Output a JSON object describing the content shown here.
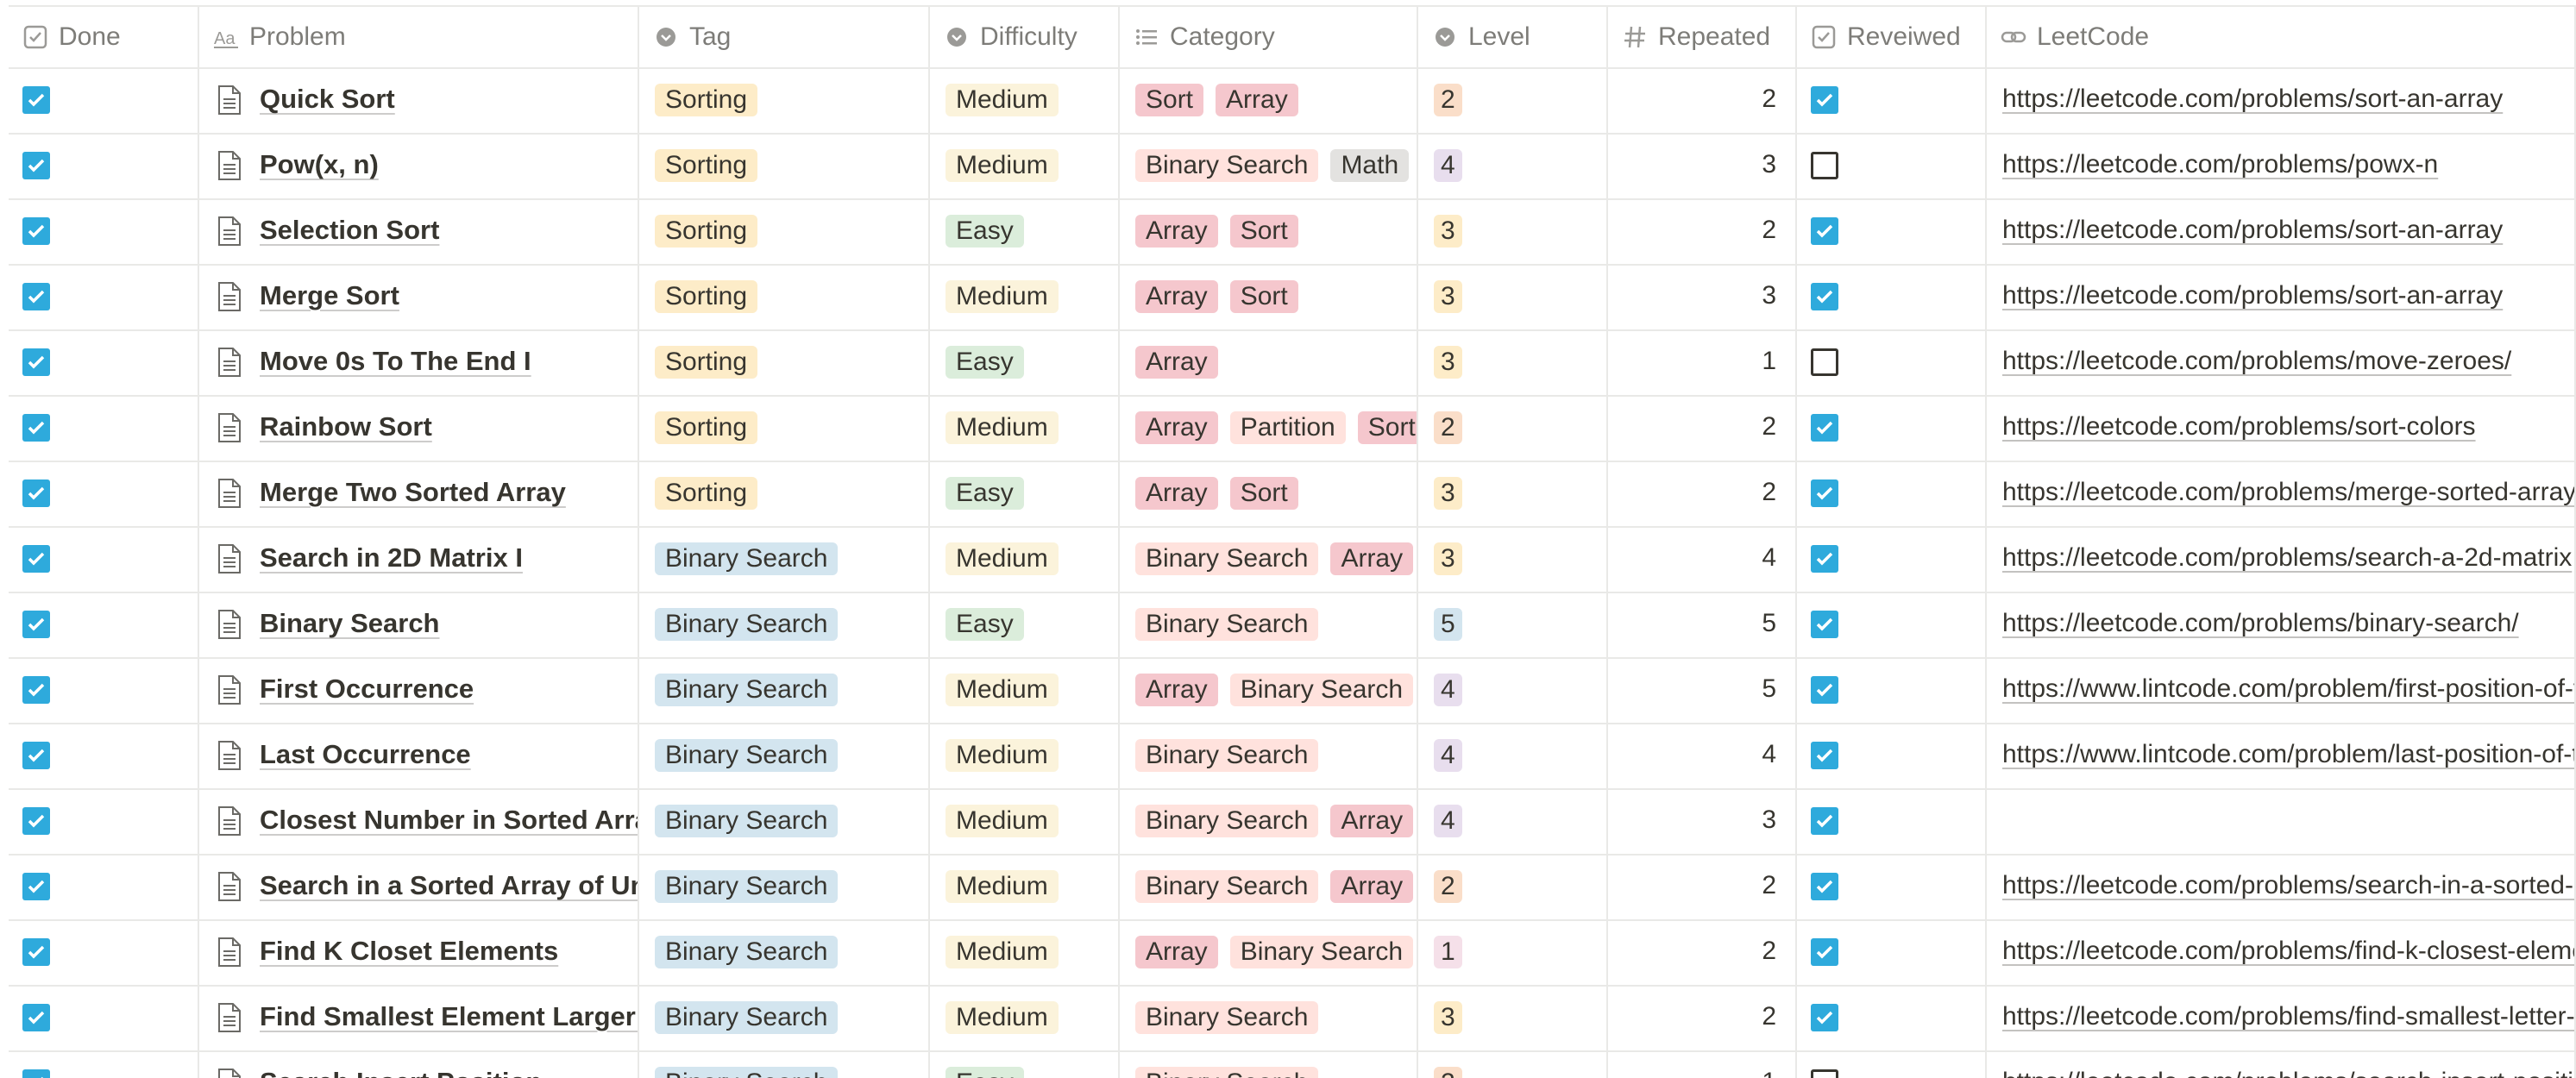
{
  "columns": {
    "done": "Done",
    "problem": "Problem",
    "tag": "Tag",
    "difficulty": "Difficulty",
    "category": "Category",
    "level": "Level",
    "repeated": "Repeated",
    "reviewed": "Reveiwed",
    "leetcode": "LeetCode"
  },
  "icons": {
    "done": "checkbox-icon",
    "problem": "title-aa-icon",
    "tag": "select-icon",
    "difficulty": "select-icon",
    "category": "multi-select-list-icon",
    "level": "select-icon",
    "repeated": "number-hash-icon",
    "reviewed": "checkbox-icon",
    "leetcode": "url-link-icon",
    "row_page": "page-icon"
  },
  "colors": {
    "checkbox_on": "#2eaadc",
    "tag_sorting": "#fdecc8",
    "tag_binary_search": "#d3e5ef",
    "difficulty_medium": "#fbf3db",
    "difficulty_easy": "#dbeddb"
  },
  "rows": [
    {
      "done": true,
      "problem": "Quick Sort",
      "tag": "Sorting",
      "difficulty": "Medium",
      "categories": [
        {
          "label": "Sort",
          "color": "pink"
        },
        {
          "label": "Array",
          "color": "pink"
        }
      ],
      "level": {
        "label": "2",
        "color": "orange"
      },
      "repeated": "2",
      "reviewed": true,
      "leetcode": "https://leetcode.com/problems/sort-an-array"
    },
    {
      "done": true,
      "problem": "Pow(x, n)",
      "tag": "Sorting",
      "difficulty": "Medium",
      "categories": [
        {
          "label": "Binary Search",
          "color": "red"
        },
        {
          "label": "Math",
          "color": "gray"
        }
      ],
      "level": {
        "label": "4",
        "color": "purple"
      },
      "repeated": "3",
      "reviewed": false,
      "leetcode": "https://leetcode.com/problems/powx-n"
    },
    {
      "done": true,
      "problem": "Selection Sort",
      "tag": "Sorting",
      "difficulty": "Easy",
      "categories": [
        {
          "label": "Array",
          "color": "pink"
        },
        {
          "label": "Sort",
          "color": "pink"
        }
      ],
      "level": {
        "label": "3",
        "color": "yellow"
      },
      "repeated": "2",
      "reviewed": true,
      "leetcode": "https://leetcode.com/problems/sort-an-array"
    },
    {
      "done": true,
      "problem": "Merge Sort",
      "tag": "Sorting",
      "difficulty": "Medium",
      "categories": [
        {
          "label": "Array",
          "color": "pink"
        },
        {
          "label": "Sort",
          "color": "pink"
        }
      ],
      "level": {
        "label": "3",
        "color": "yellow"
      },
      "repeated": "3",
      "reviewed": true,
      "leetcode": "https://leetcode.com/problems/sort-an-array"
    },
    {
      "done": true,
      "problem": "Move 0s To The End I",
      "tag": "Sorting",
      "difficulty": "Easy",
      "categories": [
        {
          "label": "Array",
          "color": "pink"
        }
      ],
      "level": {
        "label": "3",
        "color": "yellow"
      },
      "repeated": "1",
      "reviewed": false,
      "leetcode": "https://leetcode.com/problems/move-zeroes/"
    },
    {
      "done": true,
      "problem": "Rainbow Sort",
      "tag": "Sorting",
      "difficulty": "Medium",
      "categories": [
        {
          "label": "Array",
          "color": "pink"
        },
        {
          "label": "Partition",
          "color": "red"
        },
        {
          "label": "Sort",
          "color": "pink"
        }
      ],
      "level": {
        "label": "2",
        "color": "orange"
      },
      "repeated": "2",
      "reviewed": true,
      "leetcode": "https://leetcode.com/problems/sort-colors"
    },
    {
      "done": true,
      "problem": "Merge Two Sorted Array",
      "tag": "Sorting",
      "difficulty": "Easy",
      "categories": [
        {
          "label": "Array",
          "color": "pink"
        },
        {
          "label": "Sort",
          "color": "pink"
        }
      ],
      "level": {
        "label": "3",
        "color": "yellow"
      },
      "repeated": "2",
      "reviewed": true,
      "leetcode": "https://leetcode.com/problems/merge-sorted-array"
    },
    {
      "done": true,
      "problem": "Search in 2D Matrix I",
      "tag": "Binary Search",
      "difficulty": "Medium",
      "categories": [
        {
          "label": "Binary Search",
          "color": "red"
        },
        {
          "label": "Array",
          "color": "pink"
        }
      ],
      "level": {
        "label": "3",
        "color": "yellow"
      },
      "repeated": "4",
      "reviewed": true,
      "leetcode": "https://leetcode.com/problems/search-a-2d-matrix"
    },
    {
      "done": true,
      "problem": "Binary Search",
      "tag": "Binary Search",
      "difficulty": "Easy",
      "categories": [
        {
          "label": "Binary Search",
          "color": "red"
        }
      ],
      "level": {
        "label": "5",
        "color": "blue"
      },
      "repeated": "5",
      "reviewed": true,
      "leetcode": "https://leetcode.com/problems/binary-search/"
    },
    {
      "done": true,
      "problem": "First Occurrence",
      "tag": "Binary Search",
      "difficulty": "Medium",
      "categories": [
        {
          "label": "Array",
          "color": "pink"
        },
        {
          "label": "Binary Search",
          "color": "red"
        }
      ],
      "level": {
        "label": "4",
        "color": "purple"
      },
      "repeated": "5",
      "reviewed": true,
      "leetcode": "https://www.lintcode.com/problem/first-position-of-target"
    },
    {
      "done": true,
      "problem": "Last Occurrence",
      "tag": "Binary Search",
      "difficulty": "Medium",
      "categories": [
        {
          "label": "Binary Search",
          "color": "red"
        }
      ],
      "level": {
        "label": "4",
        "color": "purple"
      },
      "repeated": "4",
      "reviewed": true,
      "leetcode": "https://www.lintcode.com/problem/last-position-of-target"
    },
    {
      "done": true,
      "problem": "Closest Number in Sorted Array",
      "tag": "Binary Search",
      "difficulty": "Medium",
      "categories": [
        {
          "label": "Binary Search",
          "color": "red"
        },
        {
          "label": "Array",
          "color": "pink"
        }
      ],
      "level": {
        "label": "4",
        "color": "purple"
      },
      "repeated": "3",
      "reviewed": true,
      "leetcode": ""
    },
    {
      "done": true,
      "problem": "Search in a Sorted Array of Unknown Size",
      "tag": "Binary Search",
      "difficulty": "Medium",
      "categories": [
        {
          "label": "Binary Search",
          "color": "red"
        },
        {
          "label": "Array",
          "color": "pink"
        }
      ],
      "level": {
        "label": "2",
        "color": "orange"
      },
      "repeated": "2",
      "reviewed": true,
      "leetcode": "https://leetcode.com/problems/search-in-a-sorted-array-of-unknown-size"
    },
    {
      "done": true,
      "problem": "Find K Closet Elements",
      "tag": "Binary Search",
      "difficulty": "Medium",
      "categories": [
        {
          "label": "Array",
          "color": "pink"
        },
        {
          "label": "Binary Search",
          "color": "red"
        }
      ],
      "level": {
        "label": "1",
        "color": "pinklvl"
      },
      "repeated": "2",
      "reviewed": true,
      "leetcode": "https://leetcode.com/problems/find-k-closest-elements"
    },
    {
      "done": true,
      "problem": "Find Smallest Element Larger than Target",
      "tag": "Binary Search",
      "difficulty": "Medium",
      "categories": [
        {
          "label": "Binary Search",
          "color": "red"
        }
      ],
      "level": {
        "label": "3",
        "color": "yellow"
      },
      "repeated": "2",
      "reviewed": true,
      "leetcode": "https://leetcode.com/problems/find-smallest-letter-greater-than-target"
    },
    {
      "done": true,
      "problem": "Search Insert Position",
      "tag": "Binary Search",
      "difficulty": "Easy",
      "categories": [
        {
          "label": "Binary Search",
          "color": "red"
        }
      ],
      "level": {
        "label": "2",
        "color": "orange"
      },
      "repeated": "1",
      "reviewed": false,
      "leetcode": "https://leetcode.com/problems/search-insert-position"
    }
  ]
}
